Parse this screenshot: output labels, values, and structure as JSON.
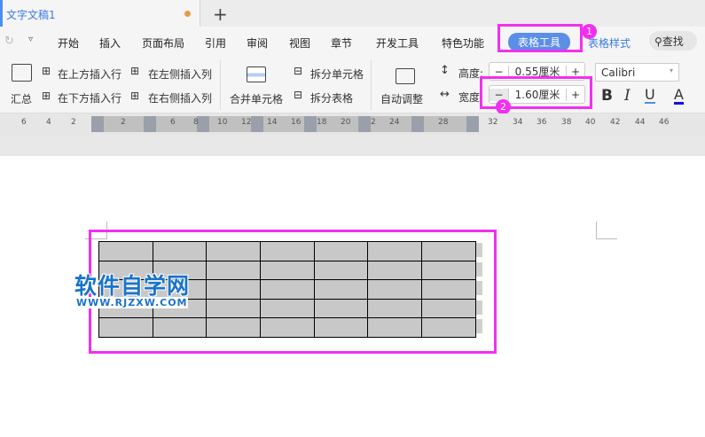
{
  "tab": {
    "title": "文字文稿1",
    "new_tab": "+"
  },
  "menu": [
    "开始",
    "插入",
    "页面布局",
    "引用",
    "审阅",
    "视图",
    "章节",
    "开发工具",
    "特色功能",
    "表格工具",
    "表格样式"
  ],
  "search": "查找",
  "ribbon": {
    "summary": "汇总",
    "insert_above": "在上方插入行",
    "insert_below": "在下方插入行",
    "insert_left": "在左侧插入列",
    "insert_right": "在右侧插入列",
    "merge": "合并单元格",
    "split_cell": "拆分单元格",
    "split_table": "拆分表格",
    "autofit": "自动调整",
    "height_label": "高度:",
    "height_value": "0.55厘米",
    "width_label": "宽度:",
    "width_value": "1.60厘米",
    "minus": "−",
    "plus": "+",
    "font": "Calibri",
    "bold": "B",
    "italic": "I",
    "underline": "U",
    "font_color": "A"
  },
  "annotations": [
    "1",
    "2"
  ],
  "ruler": [
    "6",
    "4",
    "2",
    "2",
    "6",
    "8",
    "10",
    "12",
    "14",
    "16",
    "18",
    "20",
    "2",
    "24",
    "28",
    "32",
    "34",
    "36",
    "38",
    "40",
    "42",
    "44",
    "46"
  ],
  "watermark": {
    "title": "软件自学网",
    "url": "WWW.RJZXW.COM"
  },
  "table": {
    "rows": 5,
    "cols": 7
  },
  "colors": {
    "accent": "#5b8fe6",
    "highlight": "#f22ff0",
    "cell": "#c8c8c8"
  }
}
